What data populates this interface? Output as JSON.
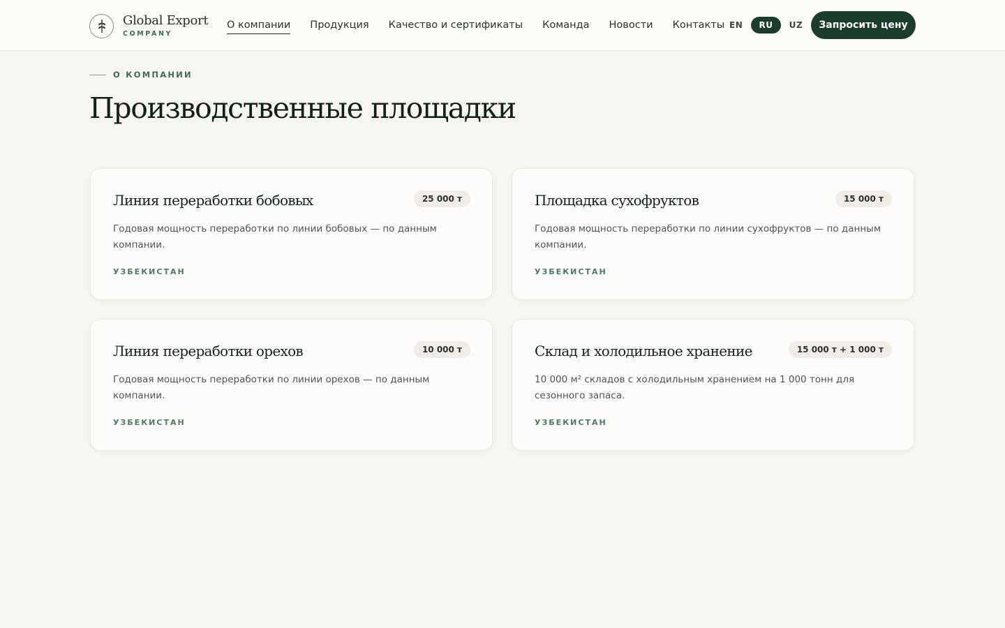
{
  "header": {
    "logo": {
      "title": "Global Export",
      "subtitle": "COMPANY",
      "icon": "wheat-icon"
    },
    "nav": [
      {
        "label": "О компании",
        "active": true
      },
      {
        "label": "Продукция",
        "active": false
      },
      {
        "label": "Качество и сертификаты",
        "active": false
      },
      {
        "label": "Команда",
        "active": false
      },
      {
        "label": "Новости",
        "active": false
      },
      {
        "label": "Контакты",
        "active": false
      }
    ],
    "languages": [
      {
        "label": "EN",
        "active": false
      },
      {
        "label": "RU",
        "active": true
      },
      {
        "label": "UZ",
        "active": false
      }
    ],
    "cta_label": "Запросить цену"
  },
  "section": {
    "eyebrow": "О КОМПАНИИ",
    "title": "Производственные площадки"
  },
  "cards": [
    {
      "title": "Линия переработки бобовых",
      "badge": "25 000 т",
      "description": "Годовая мощность переработки по линии бобовых — по данным компании.",
      "location": "УЗБЕКИСТАН"
    },
    {
      "title": "Площадка сухофруктов",
      "badge": "15 000 т",
      "description": "Годовая мощность переработки по линии сухофруктов — по данным компании.",
      "location": "УЗБЕКИСТАН"
    },
    {
      "title": "Линия переработки орехов",
      "badge": "10 000 т",
      "description": "Годовая мощность переработки по линии орехов — по данным компании.",
      "location": "УЗБЕКИСТАН"
    },
    {
      "title": "Склад и холодильное хранение",
      "badge": "15 000 т + 1 000 т",
      "description": "10 000 м² складов с холодильным хранением на 1 000 тонн для сезонного запаса.",
      "location": "УЗБЕКИСТАН"
    }
  ],
  "colors": {
    "background": "#f8f6f1",
    "accent": "#1c3d2b",
    "eyebrow": "#3f6b51"
  }
}
